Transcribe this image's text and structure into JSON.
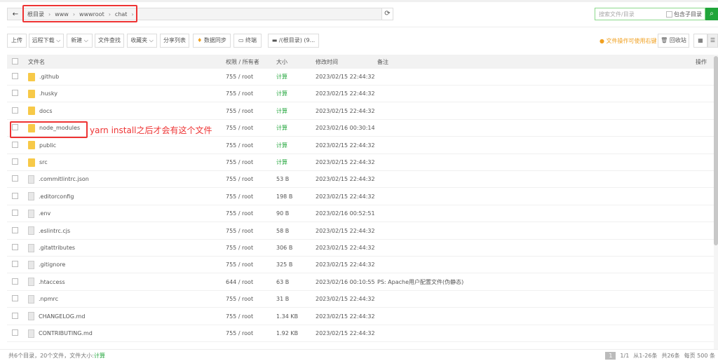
{
  "path": {
    "back": "←",
    "crumbs": [
      "根目录",
      "www",
      "wwwroot",
      "chat"
    ],
    "refresh": "⟳"
  },
  "search": {
    "placeholder": "搜索文件/目录",
    "subdir": "包含子目录",
    "icon": "search-icon"
  },
  "toolbar": [
    "上传",
    "远程下载 ⌵",
    "新建 ⌵",
    "文件查找",
    "收藏夹 ⌵",
    "分享列表",
    "数据同步",
    "终端",
    "/(根目录) (9..."
  ],
  "tip": "文件操作可使用右键",
  "recycle": "回收站",
  "header": {
    "name": "文件名",
    "perm": "权限 / 所有者",
    "size": "大小",
    "mtime": "修改时间",
    "note": "备注",
    "ops": "操作"
  },
  "rows": [
    {
      "name": ".github",
      "type": "folder",
      "perm": "755 / root",
      "size": "计算",
      "mtime": "2023/02/15 22:44:32",
      "note": ""
    },
    {
      "name": ".husky",
      "type": "folder",
      "perm": "755 / root",
      "size": "计算",
      "mtime": "2023/02/15 22:44:32",
      "note": ""
    },
    {
      "name": "docs",
      "type": "folder",
      "perm": "755 / root",
      "size": "计算",
      "mtime": "2023/02/15 22:44:32",
      "note": ""
    },
    {
      "name": "node_modules",
      "type": "folder",
      "perm": "755 / root",
      "size": "计算",
      "mtime": "2023/02/16 00:30:14",
      "note": ""
    },
    {
      "name": "public",
      "type": "folder",
      "perm": "755 / root",
      "size": "计算",
      "mtime": "2023/02/15 22:44:32",
      "note": ""
    },
    {
      "name": "src",
      "type": "folder",
      "perm": "755 / root",
      "size": "计算",
      "mtime": "2023/02/15 22:44:32",
      "note": ""
    },
    {
      "name": ".commitlintrc.json",
      "type": "file",
      "perm": "755 / root",
      "size": "53 B",
      "mtime": "2023/02/15 22:44:32",
      "note": ""
    },
    {
      "name": ".editorconfig",
      "type": "file",
      "perm": "755 / root",
      "size": "198 B",
      "mtime": "2023/02/15 22:44:32",
      "note": ""
    },
    {
      "name": ".env",
      "type": "file",
      "perm": "755 / root",
      "size": "90 B",
      "mtime": "2023/02/16 00:52:51",
      "note": ""
    },
    {
      "name": ".eslintrc.cjs",
      "type": "file",
      "perm": "755 / root",
      "size": "58 B",
      "mtime": "2023/02/15 22:44:32",
      "note": ""
    },
    {
      "name": ".gitattributes",
      "type": "file",
      "perm": "755 / root",
      "size": "306 B",
      "mtime": "2023/02/15 22:44:32",
      "note": ""
    },
    {
      "name": ".gitignore",
      "type": "file",
      "perm": "755 / root",
      "size": "325 B",
      "mtime": "2023/02/15 22:44:32",
      "note": ""
    },
    {
      "name": ".htaccess",
      "type": "file",
      "perm": "644 / root",
      "size": "63 B",
      "mtime": "2023/02/16 00:10:55",
      "note": "PS: Apache用户配置文件(伪静态)"
    },
    {
      "name": ".npmrc",
      "type": "file",
      "perm": "755 / root",
      "size": "31 B",
      "mtime": "2023/02/15 22:44:32",
      "note": ""
    },
    {
      "name": "CHANGELOG.md",
      "type": "file",
      "perm": "755 / root",
      "size": "1.34 KB",
      "mtime": "2023/02/15 22:44:32",
      "note": ""
    },
    {
      "name": "CONTRIBUTING.md",
      "type": "file",
      "perm": "755 / root",
      "size": "1.92 KB",
      "mtime": "2023/02/15 22:44:32",
      "note": ""
    }
  ],
  "annotation": "yarn install之后才会有这个文件",
  "footer": {
    "summary": "共6个目录，20个文件，文件大小:",
    "calc": "计算",
    "page": "1",
    "pages": "1/1",
    "range": "从1-26条",
    "total": "共26条",
    "per_page": "每页 500 条"
  }
}
